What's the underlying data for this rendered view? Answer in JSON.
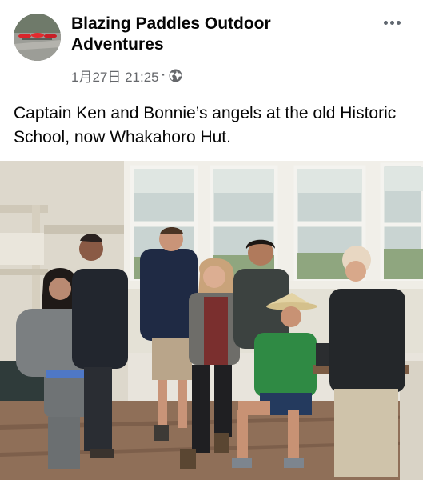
{
  "post": {
    "page_name": "Blazing Paddles Outdoor Adventures",
    "timestamp": "1月27日 21:25",
    "separator": "·",
    "privacy_icon": "globe-icon",
    "more_icon": "more-options-icon",
    "caption": "Captain Ken and Bonnie’s angels at the old Historic School, now Whakahoro Hut."
  },
  "colors": {
    "name": "#050505",
    "meta": "#65676b"
  }
}
